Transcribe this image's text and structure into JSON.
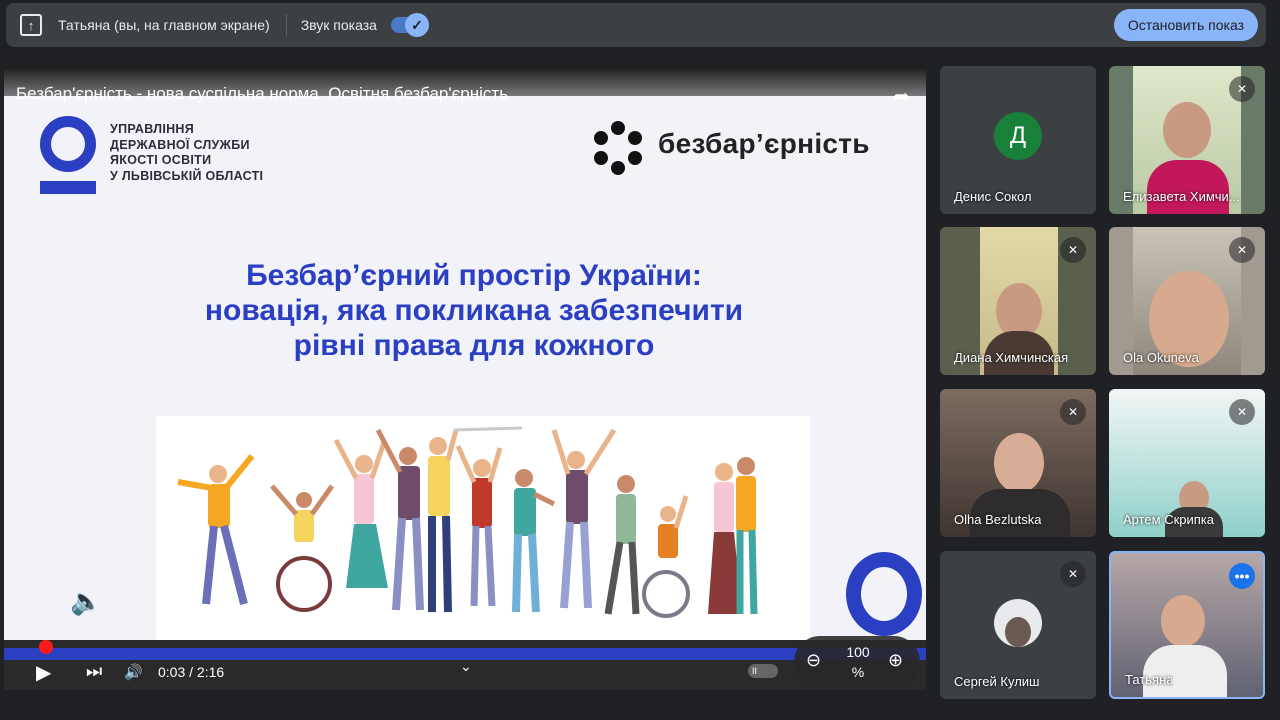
{
  "topbar": {
    "presenter_label": "Татьяна (вы, на главном экране)",
    "sound_label": "Звук показа",
    "sound_enabled": true,
    "stop_button": "Остановить показ"
  },
  "video": {
    "title": "Безбар'єрність - нова суспільна норма. Освітня безбар'єрність",
    "org_name": "УПРАВЛІННЯ\nДЕРЖАВНОЇ СЛУЖБИ\nЯКОСТІ ОСВІТИ\nУ ЛЬВІВСЬКІЙ ОБЛАСТІ",
    "brand": "безбар’єрність",
    "heading": "Безбар’єрний простір України:\nновація, яка покликана забезпечити\nрівні права для кожного",
    "time": "0:03 / 2:16",
    "progress": 0.023,
    "zoom": "100\n%"
  },
  "participants": [
    {
      "name": "Денис Сокол",
      "initial": "Д",
      "avatar_color": "#188038",
      "muted": false
    },
    {
      "name": "Елизавета Химчи...",
      "muted": true
    },
    {
      "name": "Диана Химчинская",
      "muted": true
    },
    {
      "name": "Ola Okuneva",
      "muted": true
    },
    {
      "name": "Olha Bezlutska",
      "muted": true
    },
    {
      "name": "Артем Скрипка",
      "muted": true
    },
    {
      "name": "Сергей Кулиш",
      "muted": true
    },
    {
      "name": "Татьяна",
      "muted": false,
      "active": true
    }
  ],
  "icons": {
    "present": "present-to-all-icon",
    "mic_off": "mic-off-icon",
    "more": "more-options-icon"
  },
  "colors": {
    "accent": "#8ab4f8",
    "brand_blue": "#2b3fc2",
    "progress_red": "#ff1a1a"
  }
}
